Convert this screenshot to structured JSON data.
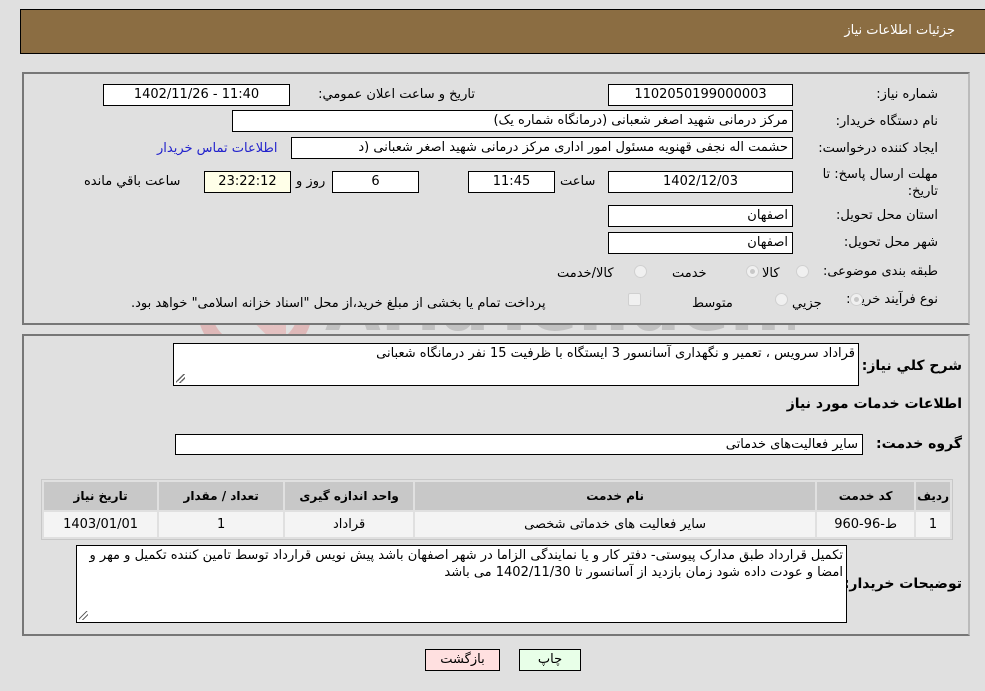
{
  "header": {
    "title": "جزئیات اطلاعات نیاز"
  },
  "details": {
    "need_number_label": "شماره نیاز:",
    "need_number": "1102050199000003",
    "announce_label": "تاریخ و ساعت اعلان عمومي:",
    "announce_value": "1402/11/26 - 11:40",
    "buyer_org_label": "نام دستگاه خریدار:",
    "buyer_org": "مرکز درمانی شهید اصغر شعبانی (درمانگاه شماره یک)",
    "requester_label": "ایجاد کننده درخواست:",
    "requester": "حشمت اله نجفی قهنویه مسئول امور اداری مرکز درمانی شهید اصغر شعبانی (د",
    "contact_link": "اطلاعات تماس خریدار",
    "deadline_label": "مهلت ارسال پاسخ: تا تاریخ:",
    "deadline_date": "1402/12/03",
    "time_label": "ساعت",
    "deadline_time": "11:45",
    "days_value": "6",
    "days_label": "روز و",
    "remaining_time": "23:22:12",
    "remaining_label": "ساعت باقي مانده",
    "province_label": "استان محل تحویل:",
    "province": "اصفهان",
    "city_label": "شهر محل تحویل:",
    "city": "اصفهان",
    "category_label": "طبقه بندی موضوعی:",
    "category_options": [
      {
        "label": "کالا",
        "checked": false
      },
      {
        "label": "خدمت",
        "checked": true
      },
      {
        "label": "کالا/خدمت",
        "checked": false
      }
    ],
    "process_label": "نوع فرآیند خرید :",
    "process_options": [
      {
        "label": "جزيي",
        "checked": true
      },
      {
        "label": "متوسط",
        "checked": false
      }
    ],
    "treasury_note": "پرداخت تمام یا بخشی از مبلغ خرید،از محل \"اسناد خزانه اسلامی\" خواهد بود."
  },
  "description": {
    "label": "شرح كلي نياز:",
    "value": "قراداد سرویس ، تعمیر و نگهداری آسانسور 3 ایستگاه  با ظرفیت 15 نفر درمانگاه شعبانی"
  },
  "services": {
    "section_title": "اطلاعات خدمات مورد نیاز",
    "group_label": "گروه خدمت:",
    "group_value": "سایر فعالیت‌های خدماتی",
    "table": {
      "columns": [
        "ردیف",
        "کد خدمت",
        "نام خدمت",
        "واحد اندازه گیری",
        "تعداد / مقدار",
        "تاریخ نیاز"
      ],
      "rows": [
        [
          "1",
          "ط-96-960",
          "سایر فعالیت های خدماتی شخصی",
          "قراداد",
          "1",
          "1403/01/01"
        ]
      ]
    }
  },
  "buyer_notes": {
    "label": "توضیحات خریدار:",
    "value": "تکمیل قرارداد طبق مدارک  پیوستی- دفتر کار و یا نمایندگی الزاما در شهر اصفهان باشد  پیش نویس قرارداد توسط تامین کننده تکمیل و مهر و امضا و عودت داده شود زمان بازدید از آسانسور تا 1402/11/30 می باشد"
  },
  "buttons": {
    "print": "چاپ",
    "back": "بازگشت"
  },
  "watermark": {
    "text": "AriaTender.neT"
  }
}
